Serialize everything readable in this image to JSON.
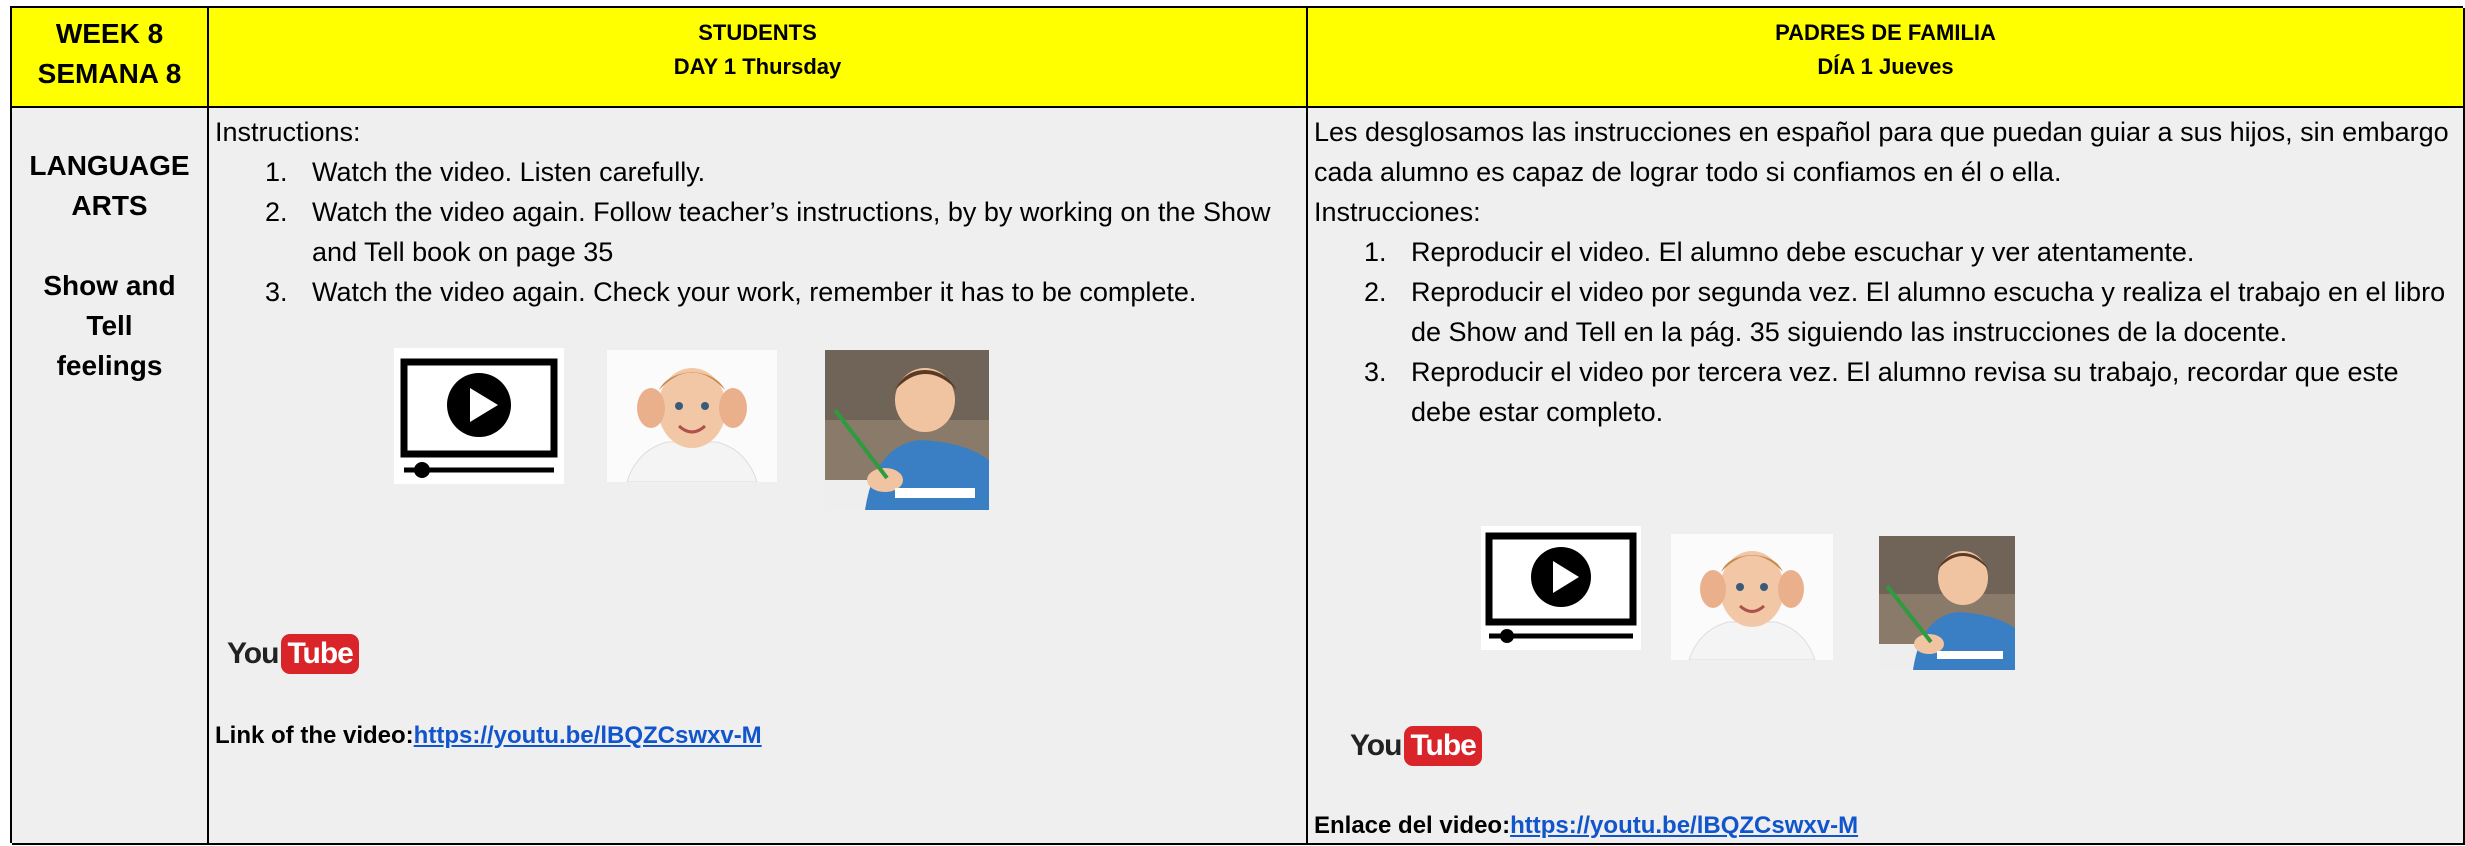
{
  "header": {
    "week_en": "WEEK 8",
    "week_es": "SEMANA 8",
    "students_title": "STUDENTS",
    "students_day": "DAY 1 Thursday",
    "parents_title": "PADRES DE FAMILIA",
    "parents_day": "DÍA 1  Jueves"
  },
  "subject": {
    "line1": "LANGUAGE",
    "line2": "ARTS",
    "line3": "Show and",
    "line4": "Tell",
    "line5": "feelings"
  },
  "students": {
    "instructions_label": "Instructions:",
    "steps": [
      {
        "num": "1.",
        "text": "Watch the video. Listen carefully."
      },
      {
        "num": "2.",
        "text": "Watch the video again. Follow teacher’s instructions, by by working on the Show and Tell book on page 35"
      },
      {
        "num": "3.",
        "text": " Watch the video again. Check your work, remember  it has to be complete."
      }
    ],
    "youtube_you": "You",
    "youtube_tube": "Tube",
    "link_label": "Link of the video:",
    "link_url": "https://youtu.be/lBQZCswxv-M"
  },
  "parents": {
    "intro": "Les desglosamos las instrucciones en español para que puedan guiar a sus hijos, sin embargo cada alumno es capaz de lograr todo si confiamos en él o ella.",
    "instructions_label": "Instrucciones:",
    "steps": [
      {
        "num": "1.",
        "text": "Reproducir el video. El alumno debe escuchar y ver atentamente."
      },
      {
        "num": "2.",
        "text": "Reproducir el video por segunda vez.  El alumno escucha y realiza el trabajo en el libro de Show and Tell en la pág. 35 siguiendo las instrucciones de la docente."
      },
      {
        "num": "3.",
        "text": "Reproducir el video por tercera vez. El alumno revisa  su trabajo, recordar que este debe estar completo."
      }
    ],
    "youtube_you": "You",
    "youtube_tube": "Tube",
    "link_label": "Enlace del video:",
    "link_url": "https://youtu.be/lBQZCswxv-M"
  },
  "icons": {
    "video": "video-player-icon",
    "listening_child": "child-listening-photo",
    "writing_child": "child-writing-photo"
  },
  "colors": {
    "header_bg": "#ffff00",
    "body_bg": "#efefef",
    "link": "#1155cc",
    "youtube_red": "#d9252a"
  }
}
